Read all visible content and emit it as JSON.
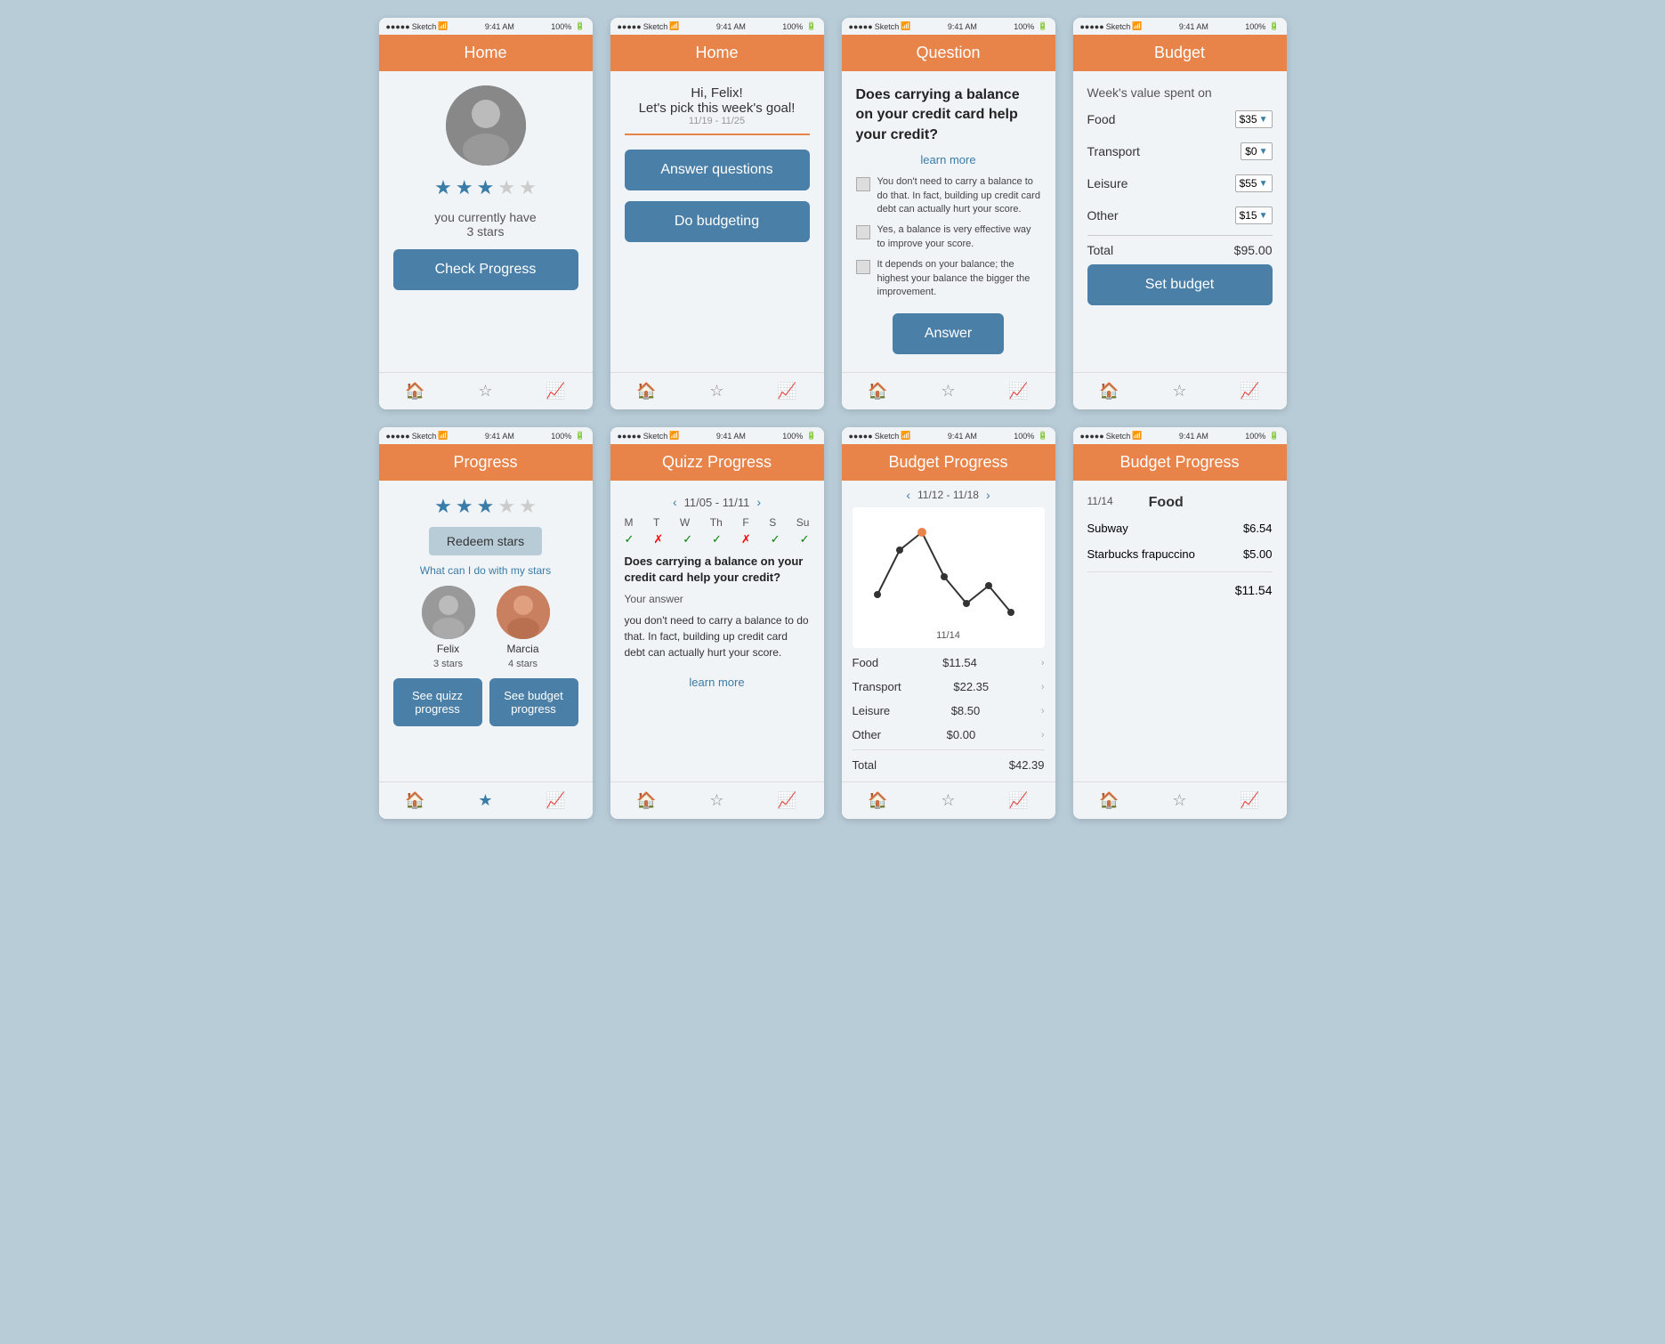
{
  "screens": {
    "home1": {
      "statusBar": {
        "signal": "●●●●●",
        "carrier": "Sketch",
        "wifi": "WiFi",
        "time": "9:41 AM",
        "battery": "100%"
      },
      "header": "Home",
      "starsCount": 3,
      "starsTotalCount": 5,
      "starsText": "you currently have\n3 stars",
      "checkProgressLabel": "Check Progress",
      "nav": [
        "home",
        "star",
        "trending-up"
      ]
    },
    "home2": {
      "statusBar": {
        "time": "9:41 AM",
        "battery": "100%"
      },
      "header": "Home",
      "greeting": "Hi, Felix!",
      "subgreeting": "Let's pick this week's goal!",
      "dateRange": "11/19 - 11/25",
      "btn1": "Answer questions",
      "btn2": "Do budgeting",
      "nav": [
        "home",
        "star",
        "trending-up"
      ]
    },
    "question": {
      "statusBar": {
        "time": "9:41 AM",
        "battery": "100%"
      },
      "header": "Question",
      "questionText": "Does carrying a balance on your credit card help your credit?",
      "learnMore": "learn more",
      "options": [
        "You don't need to carry a balance to do that. In fact, building up credit card debt can actually hurt your score.",
        "Yes, a balance is very effective way to improve your score.",
        "It depends on your balance; the highest your balance the bigger the improvement."
      ],
      "answerBtn": "Answer",
      "nav": [
        "home",
        "star",
        "trending-up"
      ]
    },
    "budget": {
      "statusBar": {
        "time": "9:41 AM",
        "battery": "100%"
      },
      "header": "Budget",
      "weekLabel": "Week's value spent on",
      "items": [
        {
          "label": "Food",
          "value": "$35"
        },
        {
          "label": "Transport",
          "value": "$0"
        },
        {
          "label": "Leisure",
          "value": "$55"
        },
        {
          "label": "Other",
          "value": "$15"
        }
      ],
      "totalLabel": "Total",
      "totalValue": "$95.00",
      "setBudgetBtn": "Set budget",
      "nav": [
        "home",
        "star",
        "trending-up"
      ]
    },
    "progress": {
      "statusBar": {
        "time": "9:41 AM",
        "battery": "100%"
      },
      "header": "Progress",
      "starsCount": 3,
      "starsTotalCount": 5,
      "redeemLabel": "Redeem stars",
      "whatLink": "What can I do with my stars",
      "friends": [
        {
          "name": "Felix",
          "stars": "3 stars"
        },
        {
          "name": "Marcia",
          "stars": "4 stars"
        }
      ],
      "btn1": "See quizz progress",
      "btn2": "See budget progress",
      "nav": [
        "home",
        "star",
        "trending-up"
      ]
    },
    "quizzProgress": {
      "statusBar": {
        "time": "9:41 AM",
        "battery": "100%"
      },
      "header": "Quizz Progress",
      "dateRange": "11/05 - 11/11",
      "days": [
        "M",
        "T",
        "W",
        "Th",
        "F",
        "S",
        "Su"
      ],
      "checks": [
        "check",
        "x",
        "check",
        "check",
        "x",
        "check",
        "check"
      ],
      "questionText": "Does carrying a balance on your credit card help your credit?",
      "yourAnswerLabel": "Your answer",
      "answerText": "you don't need to carry a balance to\ndo that. In fact, building up credit\ncard debt can actually hurt your\nscore.",
      "learnMore": "learn more",
      "nav": [
        "home",
        "star",
        "trending-up"
      ]
    },
    "budgetProgress": {
      "statusBar": {
        "time": "9:41 AM",
        "battery": "100%"
      },
      "header": "Budget Progress",
      "dateRange": "11/12 - 11/18",
      "chartDateLabel": "11/14",
      "items": [
        {
          "label": "Food",
          "value": "$11.54"
        },
        {
          "label": "Transport",
          "value": "$22.35"
        },
        {
          "label": "Leisure",
          "value": "$8.50"
        },
        {
          "label": "Other",
          "value": "$0.00"
        }
      ],
      "totalLabel": "Total",
      "totalValue": "$42.39",
      "nav": [
        "home",
        "star",
        "trending-up"
      ]
    },
    "budgetProgressDetail": {
      "statusBar": {
        "time": "9:41 AM",
        "battery": "100%"
      },
      "header": "Budget Progress",
      "date": "11/14",
      "category": "Food",
      "items": [
        {
          "label": "Subway",
          "value": "$6.54"
        },
        {
          "label": "Starbucks frapuccino",
          "value": "$5.00"
        }
      ],
      "totalValue": "$11.54",
      "nav": [
        "home",
        "star",
        "trending-up"
      ]
    }
  }
}
